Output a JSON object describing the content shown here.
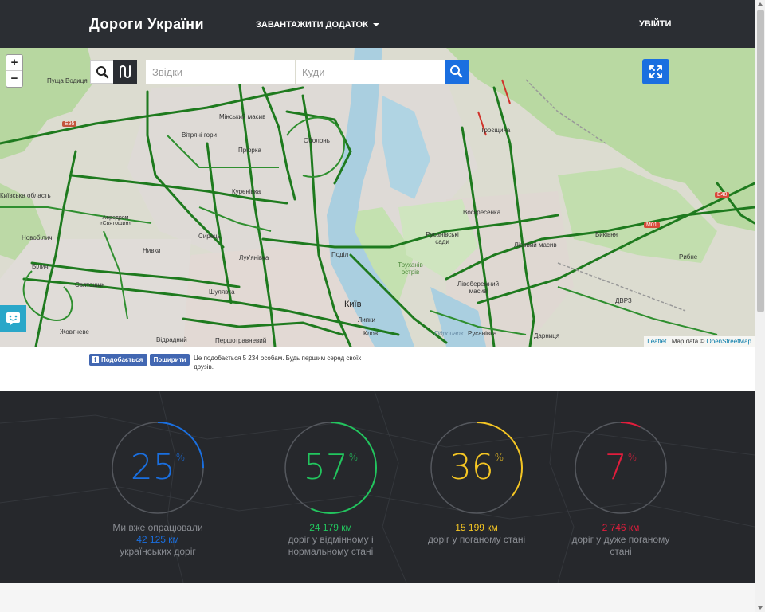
{
  "navbar": {
    "brand": "Дороги України",
    "download_label": "ЗАВАНТАЖИТИ ДОДАТОК",
    "login_label": "УВІЙТИ"
  },
  "map": {
    "zoom_in": "+",
    "zoom_out": "−",
    "from_placeholder": "Звідки",
    "to_placeholder": "Куди",
    "attribution_leaflet": "Leaflet",
    "attribution_sep": " | Map data © ",
    "attribution_osm": "OpenStreetMap",
    "labels": {
      "pushcha": "Пуща Водиця",
      "minskyi": "Мінський масив",
      "vitryani": "Вітряні гори",
      "obolon": "Оболонь",
      "priorka": "Пріорка",
      "troieshchyna": "Троєщина",
      "kyivska_oblast": "Київська область",
      "kurenivka": "Куренівка",
      "airport": "Аеродром «Святошин»",
      "novobilychi": "Новобіличі",
      "nyvky": "Нивки",
      "syrets": "Сирець",
      "lukianivka": "Лук'янівка",
      "podil": "Поділ",
      "voskresenka": "Воскресенка",
      "rusanivski_sady": "Русанівські сади",
      "trukhaniv": "Труханів острів",
      "lisovyi": "Лісовий масив",
      "bykivnia": "Биківня",
      "rybne": "Рибне",
      "bilychi": "Біличі",
      "sviatoshyn": "Святошин",
      "shuliavka": "Шулявка",
      "kyiv": "Київ",
      "livoberezhnyi": "Лівобережний масив",
      "dvrz": "ДВРЗ",
      "lypky": "Липки",
      "klov": "Клов",
      "hidropark": "Гідропарк",
      "rusanivka": "Русанівка",
      "darnytsia": "Дарниця",
      "zhovtneve": "Жовтневе",
      "vyradnyi": "Відрадний",
      "pershotravnevyi": "Першотравневий",
      "road_e95": "Е95",
      "road_m01": "М01",
      "road_e40": "Е40"
    }
  },
  "social": {
    "like_label": "Подобається",
    "share_label": "Поширити",
    "like_text": "Це подобається 5 234 особам. Будь першим серед своїх друзів."
  },
  "stats": [
    {
      "percent": "25",
      "fraction": 0.25,
      "color": "#1a6fe0",
      "line1": "Ми вже опрацювали",
      "line2": "42 125 км",
      "line3": "українських доріг"
    },
    {
      "percent": "57",
      "fraction": 0.57,
      "color": "#22c55e",
      "line1": "24 179 км",
      "line2": "доріг у відмінному і нормальному стані"
    },
    {
      "percent": "36",
      "fraction": 0.36,
      "color": "#f5c623",
      "line1": "15 199 км",
      "line2": "доріг у поганому стані"
    },
    {
      "percent": "7",
      "fraction": 0.07,
      "color": "#e11d3c",
      "line1": "2 746 км",
      "line2": "доріг у дуже поганому стані"
    }
  ],
  "percent_sign": "%"
}
